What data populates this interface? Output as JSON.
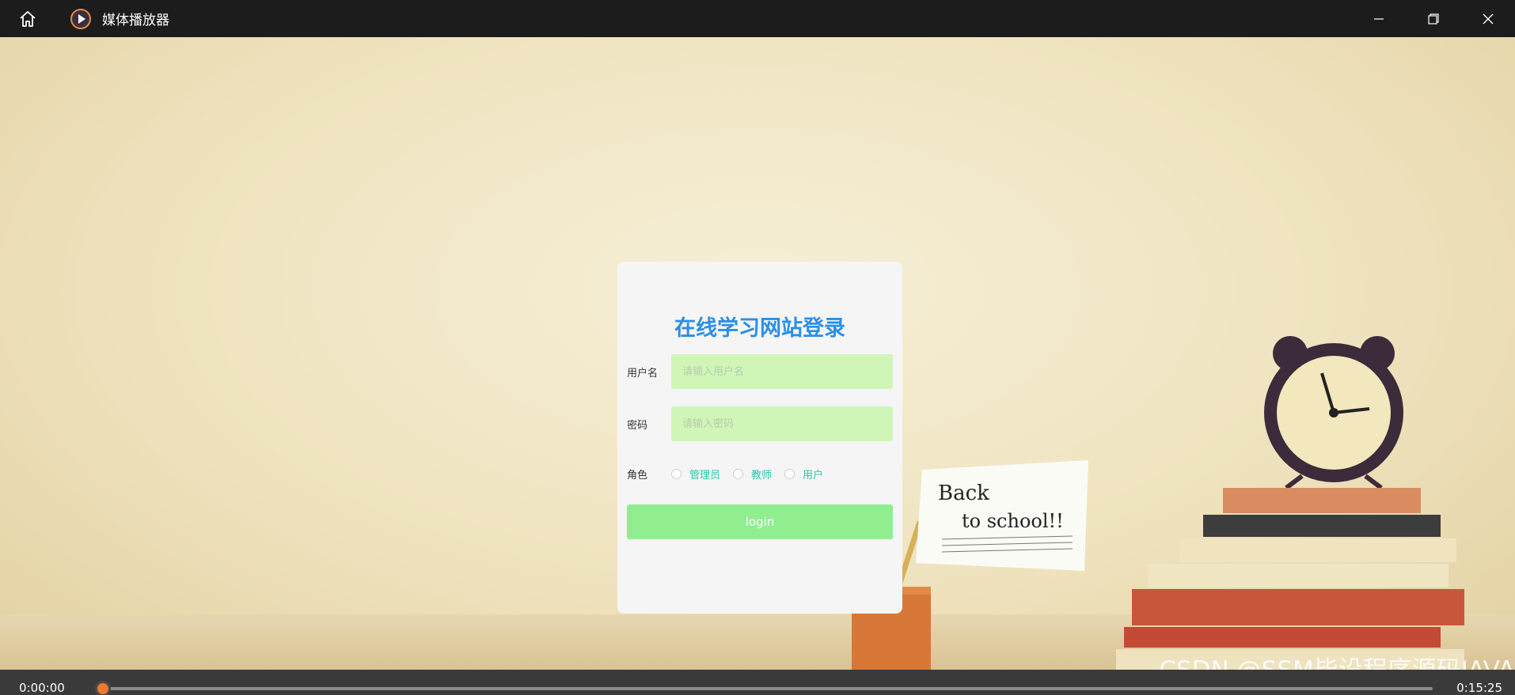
{
  "window": {
    "title": "媒体播放器"
  },
  "login": {
    "title": "在线学习网站登录",
    "username_label": "用户名",
    "username_placeholder": "请输入用户名",
    "password_label": "密码",
    "password_placeholder": "请输入密码",
    "role_label": "角色",
    "roles": [
      "管理员",
      "教师",
      "用户"
    ],
    "button_label": "login"
  },
  "player": {
    "current_time": "0:00:00",
    "total_time": "0:15:25",
    "progress": 0.0
  },
  "watermark": "CSDN @SSM毕设程序源码JAVA"
}
